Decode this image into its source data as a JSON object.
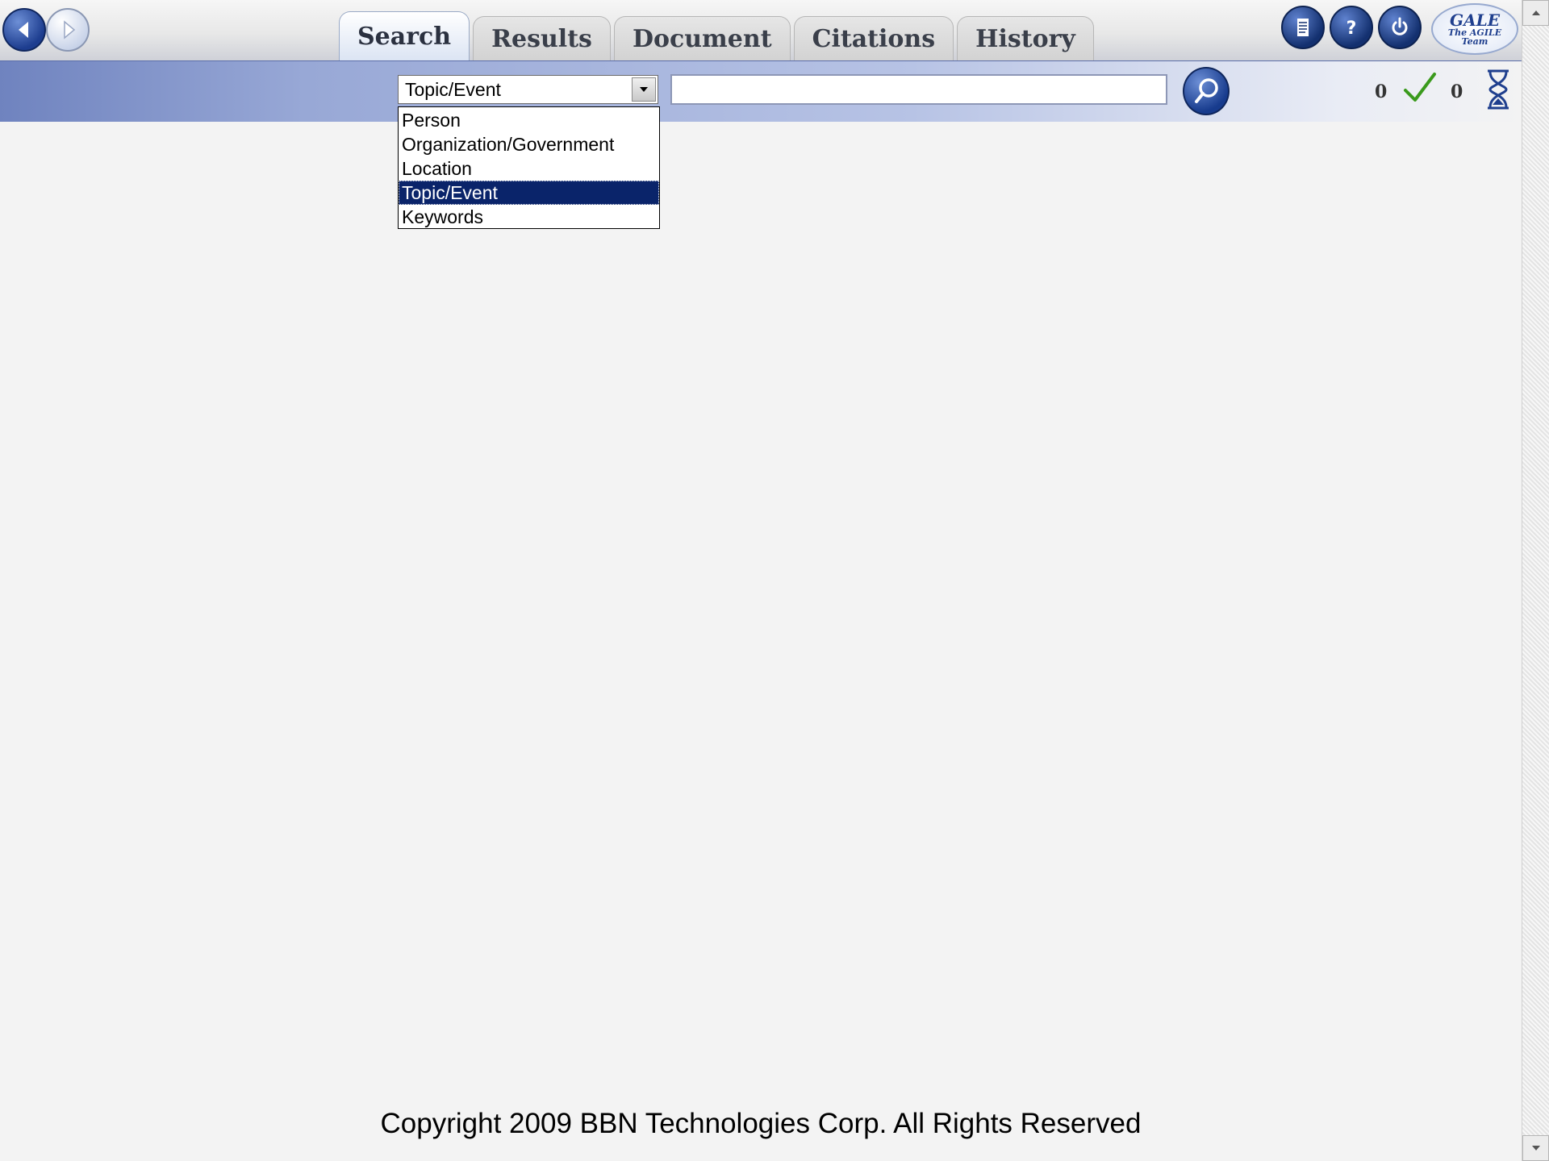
{
  "nav": {
    "back_icon": "back-arrow-icon",
    "forward_icon": "forward-arrow-icon"
  },
  "tabs": [
    {
      "label": "Search",
      "active": true
    },
    {
      "label": "Results",
      "active": false
    },
    {
      "label": "Document",
      "active": false
    },
    {
      "label": "Citations",
      "active": false
    },
    {
      "label": "History",
      "active": false
    }
  ],
  "toolbar_icons": [
    "document-icon",
    "help-icon",
    "power-icon"
  ],
  "logo": {
    "line1": "GALE",
    "line2": "The AGILE",
    "line3": "Team"
  },
  "search": {
    "type_selected": "Topic/Event",
    "query_value": "",
    "options": [
      "Person",
      "Organization/Government",
      "Location",
      "Topic/Event",
      "Keywords"
    ]
  },
  "status": {
    "count_left": "0",
    "count_right": "0"
  },
  "colors": {
    "selection_bg": "#0a246a",
    "accent_blue": "#1d3d8f",
    "check_green": "#3a9a1c"
  },
  "footer": {
    "copyright": "Copyright 2009 BBN Technologies Corp. All Rights Reserved"
  }
}
